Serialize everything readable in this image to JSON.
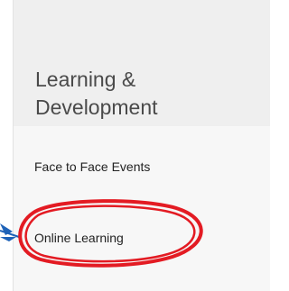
{
  "menu": {
    "section_title": "Learning &\nDevelopment",
    "items": [
      {
        "label": "Face to Face Events"
      },
      {
        "label": "Online Learning"
      }
    ]
  },
  "icons": {
    "section_toggle": "chevron-up-icon",
    "annotation_arrow": "arrow-icon",
    "annotation_highlight": "highlight-ellipse"
  },
  "colors": {
    "header_bg": "#efefef",
    "body_bg": "#f7f7f7",
    "annotation": "#e31b23",
    "arrow": "#1f63b8"
  }
}
